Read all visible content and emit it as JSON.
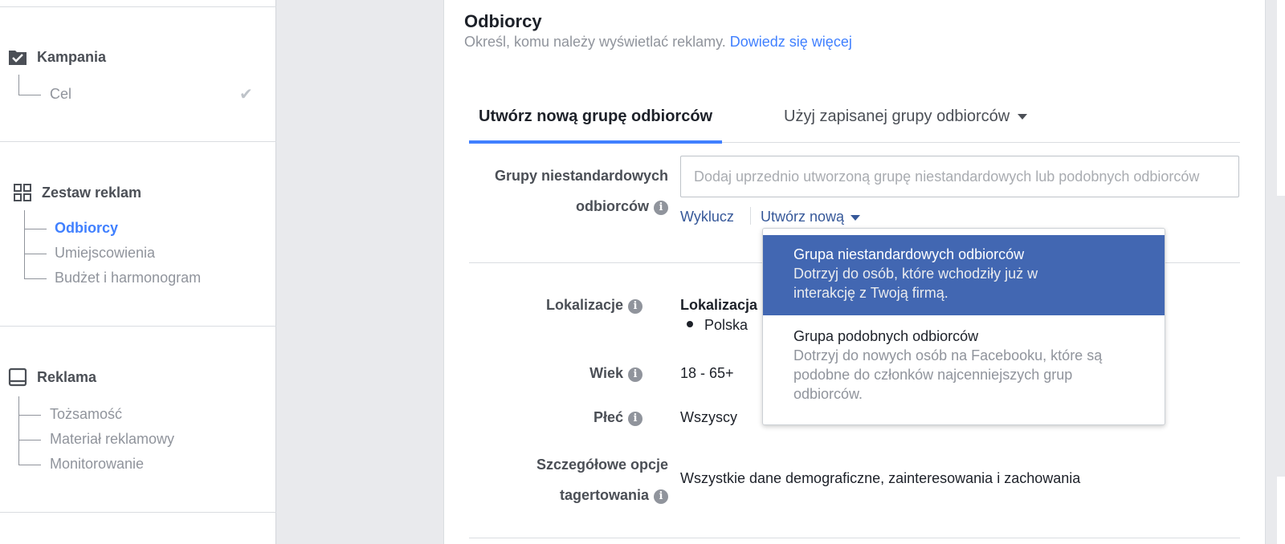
{
  "sidebar": {
    "campaign": {
      "title": "Kampania",
      "items": [
        {
          "label": "Cel"
        }
      ]
    },
    "adset": {
      "title": "Zestaw reklam",
      "items": [
        {
          "label": "Odbiorcy"
        },
        {
          "label": "Umiejscowienia"
        },
        {
          "label": "Budżet i harmonogram"
        }
      ]
    },
    "ad": {
      "title": "Reklama",
      "items": [
        {
          "label": "Tożsamość"
        },
        {
          "label": "Materiał reklamowy"
        },
        {
          "label": "Monitorowanie"
        }
      ]
    }
  },
  "audience": {
    "title": "Odbiorcy",
    "subtitle": "Określ, komu należy wyświetlać reklamy.",
    "learn_more": "Dowiedz się więcej",
    "tabs": [
      {
        "label": "Utwórz nową grupę odbiorców"
      },
      {
        "label": "Użyj zapisanej grupy odbiorców"
      }
    ],
    "custom_audiences": {
      "label_line1": "Grupy niestandardowych",
      "label_line2": "odbiorców",
      "placeholder": "Dodaj uprzednio utworzoną grupę niestandardowych lub podobnych odbiorców",
      "exclude": "Wyklucz",
      "create_new": "Utwórz nową"
    },
    "dropdown": [
      {
        "title": "Grupa niestandardowych odbiorców",
        "desc_line1": "Dotrzyj do osób, które wchodziły już w",
        "desc_line2": "interakcję z Twoją firmą."
      },
      {
        "title": "Grupa podobnych odbiorców",
        "desc_line1": "Dotrzyj do nowych osób na Facebooku, które są",
        "desc_line2": "podobne do członków najcenniejszych grup",
        "desc_line3": "odbiorców."
      }
    ],
    "locations": {
      "label": "Lokalizacje",
      "heading": "Lokalizacja",
      "value": "Polska"
    },
    "age": {
      "label": "Wiek",
      "value": "18 - 65+"
    },
    "gender": {
      "label": "Płeć",
      "value": "Wszyscy"
    },
    "detailed": {
      "label_line1": "Szczegółowe opcje",
      "label_line2": "tagertowania",
      "value": "Wszystkie dane demograficzne, zainteresowania i zachowania"
    }
  },
  "colors": {
    "accent": "#4080ff",
    "link": "#365899",
    "selected": "#4267b2"
  }
}
